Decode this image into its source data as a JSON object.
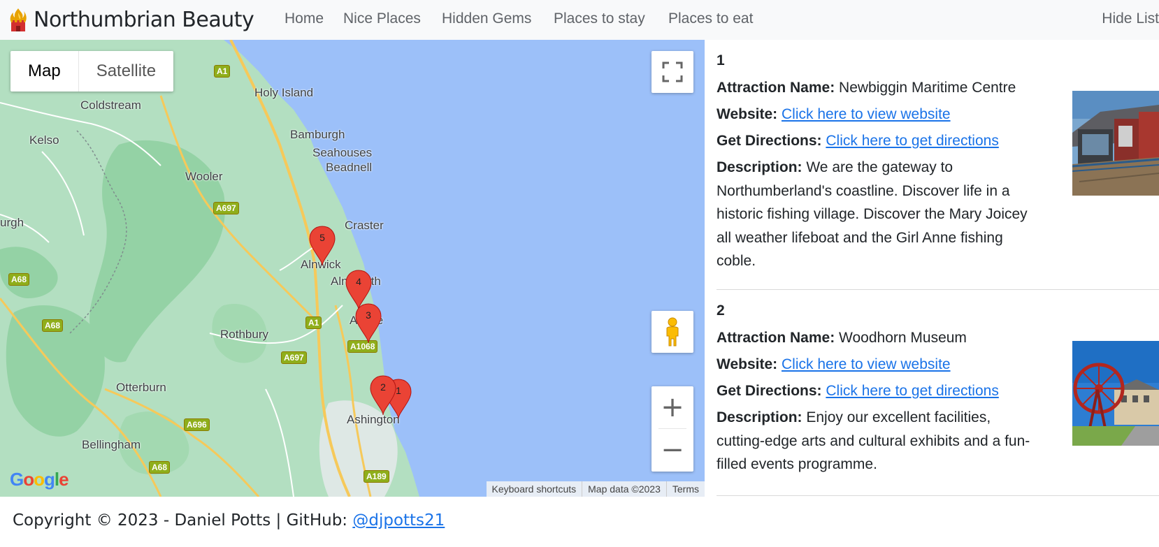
{
  "navbar": {
    "brand": "Northumbrian Beauty",
    "links": [
      "Home",
      "Nice Places",
      "Hidden Gems",
      "Places to stay",
      "Places to eat"
    ],
    "right_link": "Hide List"
  },
  "map": {
    "map_types": [
      "Map",
      "Satellite"
    ],
    "active_type": "Map",
    "labels": [
      "Holy Island",
      "Coldstream",
      "Kelso",
      "Bamburgh",
      "Seahouses",
      "Beadnell",
      "Wooler",
      "urgh",
      "Craster",
      "Alnwick",
      "Alnmouth",
      "Amble",
      "Rothbury",
      "Otterburn",
      "Ashington",
      "Bellingham"
    ],
    "road_shields": [
      "A1",
      "A697",
      "A68",
      "A68",
      "A1",
      "A1068",
      "A697",
      "A696",
      "A68",
      "A189"
    ],
    "markers": [
      "5",
      "4",
      "3",
      "2",
      "1"
    ],
    "google_logo": "Google",
    "attribution": [
      "Keyboard shortcuts",
      "Map data ©2023",
      "Terms"
    ],
    "zoom_in": "+",
    "zoom_out": "−"
  },
  "list": {
    "field_labels": {
      "name": "Attraction Name:",
      "website": "Website:",
      "directions": "Get Directions:",
      "description": "Description:"
    },
    "items": [
      {
        "number": "1",
        "name": "Newbiggin Maritime Centre",
        "website_text": "Click here to view website",
        "directions_text": "Click here to get directions",
        "description": "We are the gateway to Northumberland's coastline. Discover life in a historic fishing village. Discover the Mary Joicey all weather lifeboat and the Girl Anne fishing coble."
      },
      {
        "number": "2",
        "name": "Woodhorn Museum",
        "website_text": "Click here to view website",
        "directions_text": "Click here to get directions",
        "description": "Enjoy our excellent facilities, cutting-edge arts and cultural exhibits and a fun-filled events programme."
      }
    ]
  },
  "footer": {
    "text": "Copyright © 2023 - Daniel Potts | GitHub: ",
    "github_link": "@djpotts21"
  },
  "colors": {
    "land": "#b3dfc1",
    "forest": "#94d2a5",
    "sea": "#9cc0f9",
    "road": "#f6c95a",
    "marker": "#ea4335",
    "link": "#1a73e8"
  }
}
